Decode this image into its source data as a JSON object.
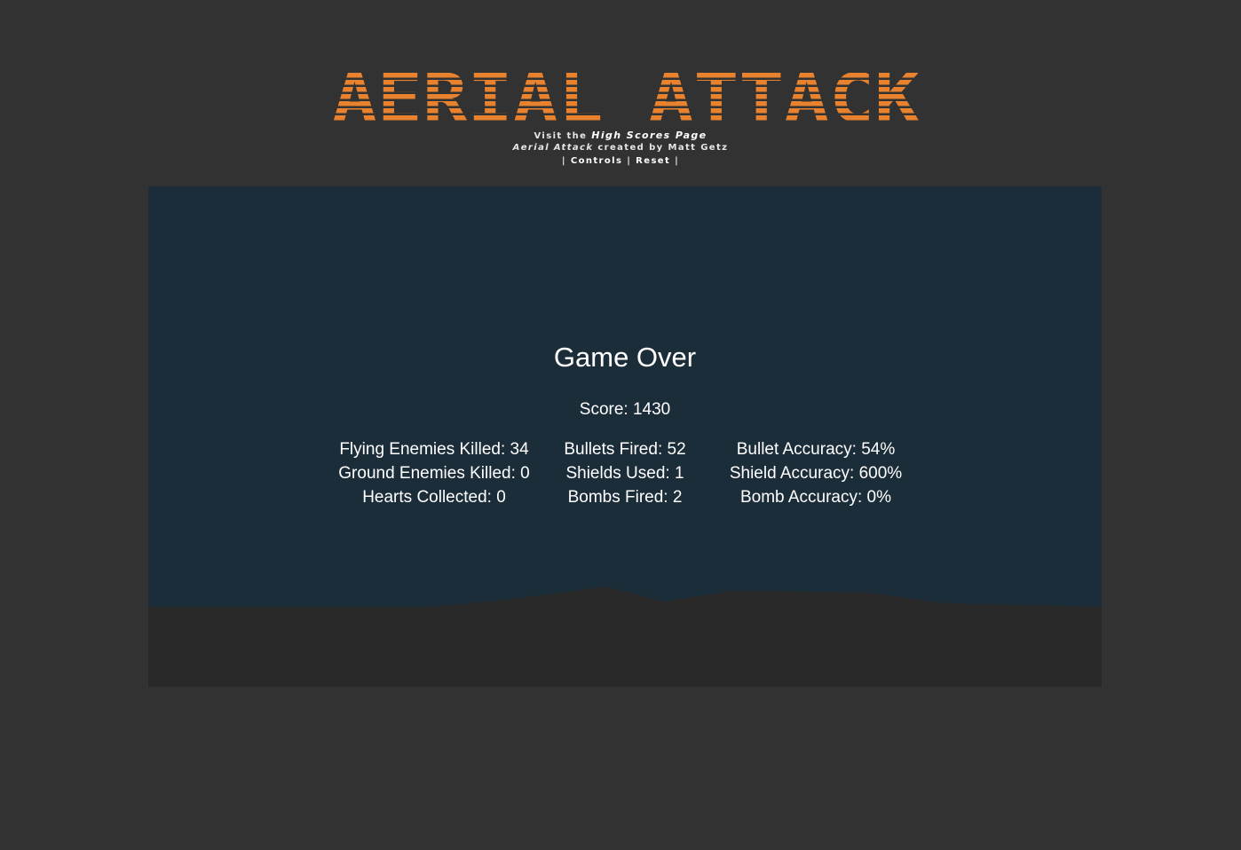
{
  "header": {
    "logo_text": "AERIAL ATTACK",
    "logo_color": "#e8822f",
    "visit_prefix": "Visit the",
    "high_scores_link": "High Scores Page",
    "credit_game": "Aerial Attack",
    "credit_suffix": "created by Matt Getz",
    "nav_sep_left": "|",
    "nav_controls": "Controls",
    "nav_sep_mid": "|",
    "nav_reset": "Reset",
    "nav_sep_right": "|"
  },
  "game": {
    "sky_color": "#1c2d3a",
    "ground_color": "#282828",
    "title": "Game Over",
    "score": "Score: 1430",
    "stats": {
      "flying_enemies_killed": "Flying Enemies Killed: 34",
      "ground_enemies_killed": "Ground Enemies Killed: 0",
      "hearts_collected": "Hearts Collected: 0",
      "bullets_fired": "Bullets Fired: 52",
      "shields_used": "Shields Used: 1",
      "bombs_fired": "Bombs Fired: 2",
      "bullet_accuracy": "Bullet Accuracy: 54%",
      "shield_accuracy": "Shield Accuracy: 600%",
      "bomb_accuracy": "Bomb Accuracy: 0%"
    }
  }
}
